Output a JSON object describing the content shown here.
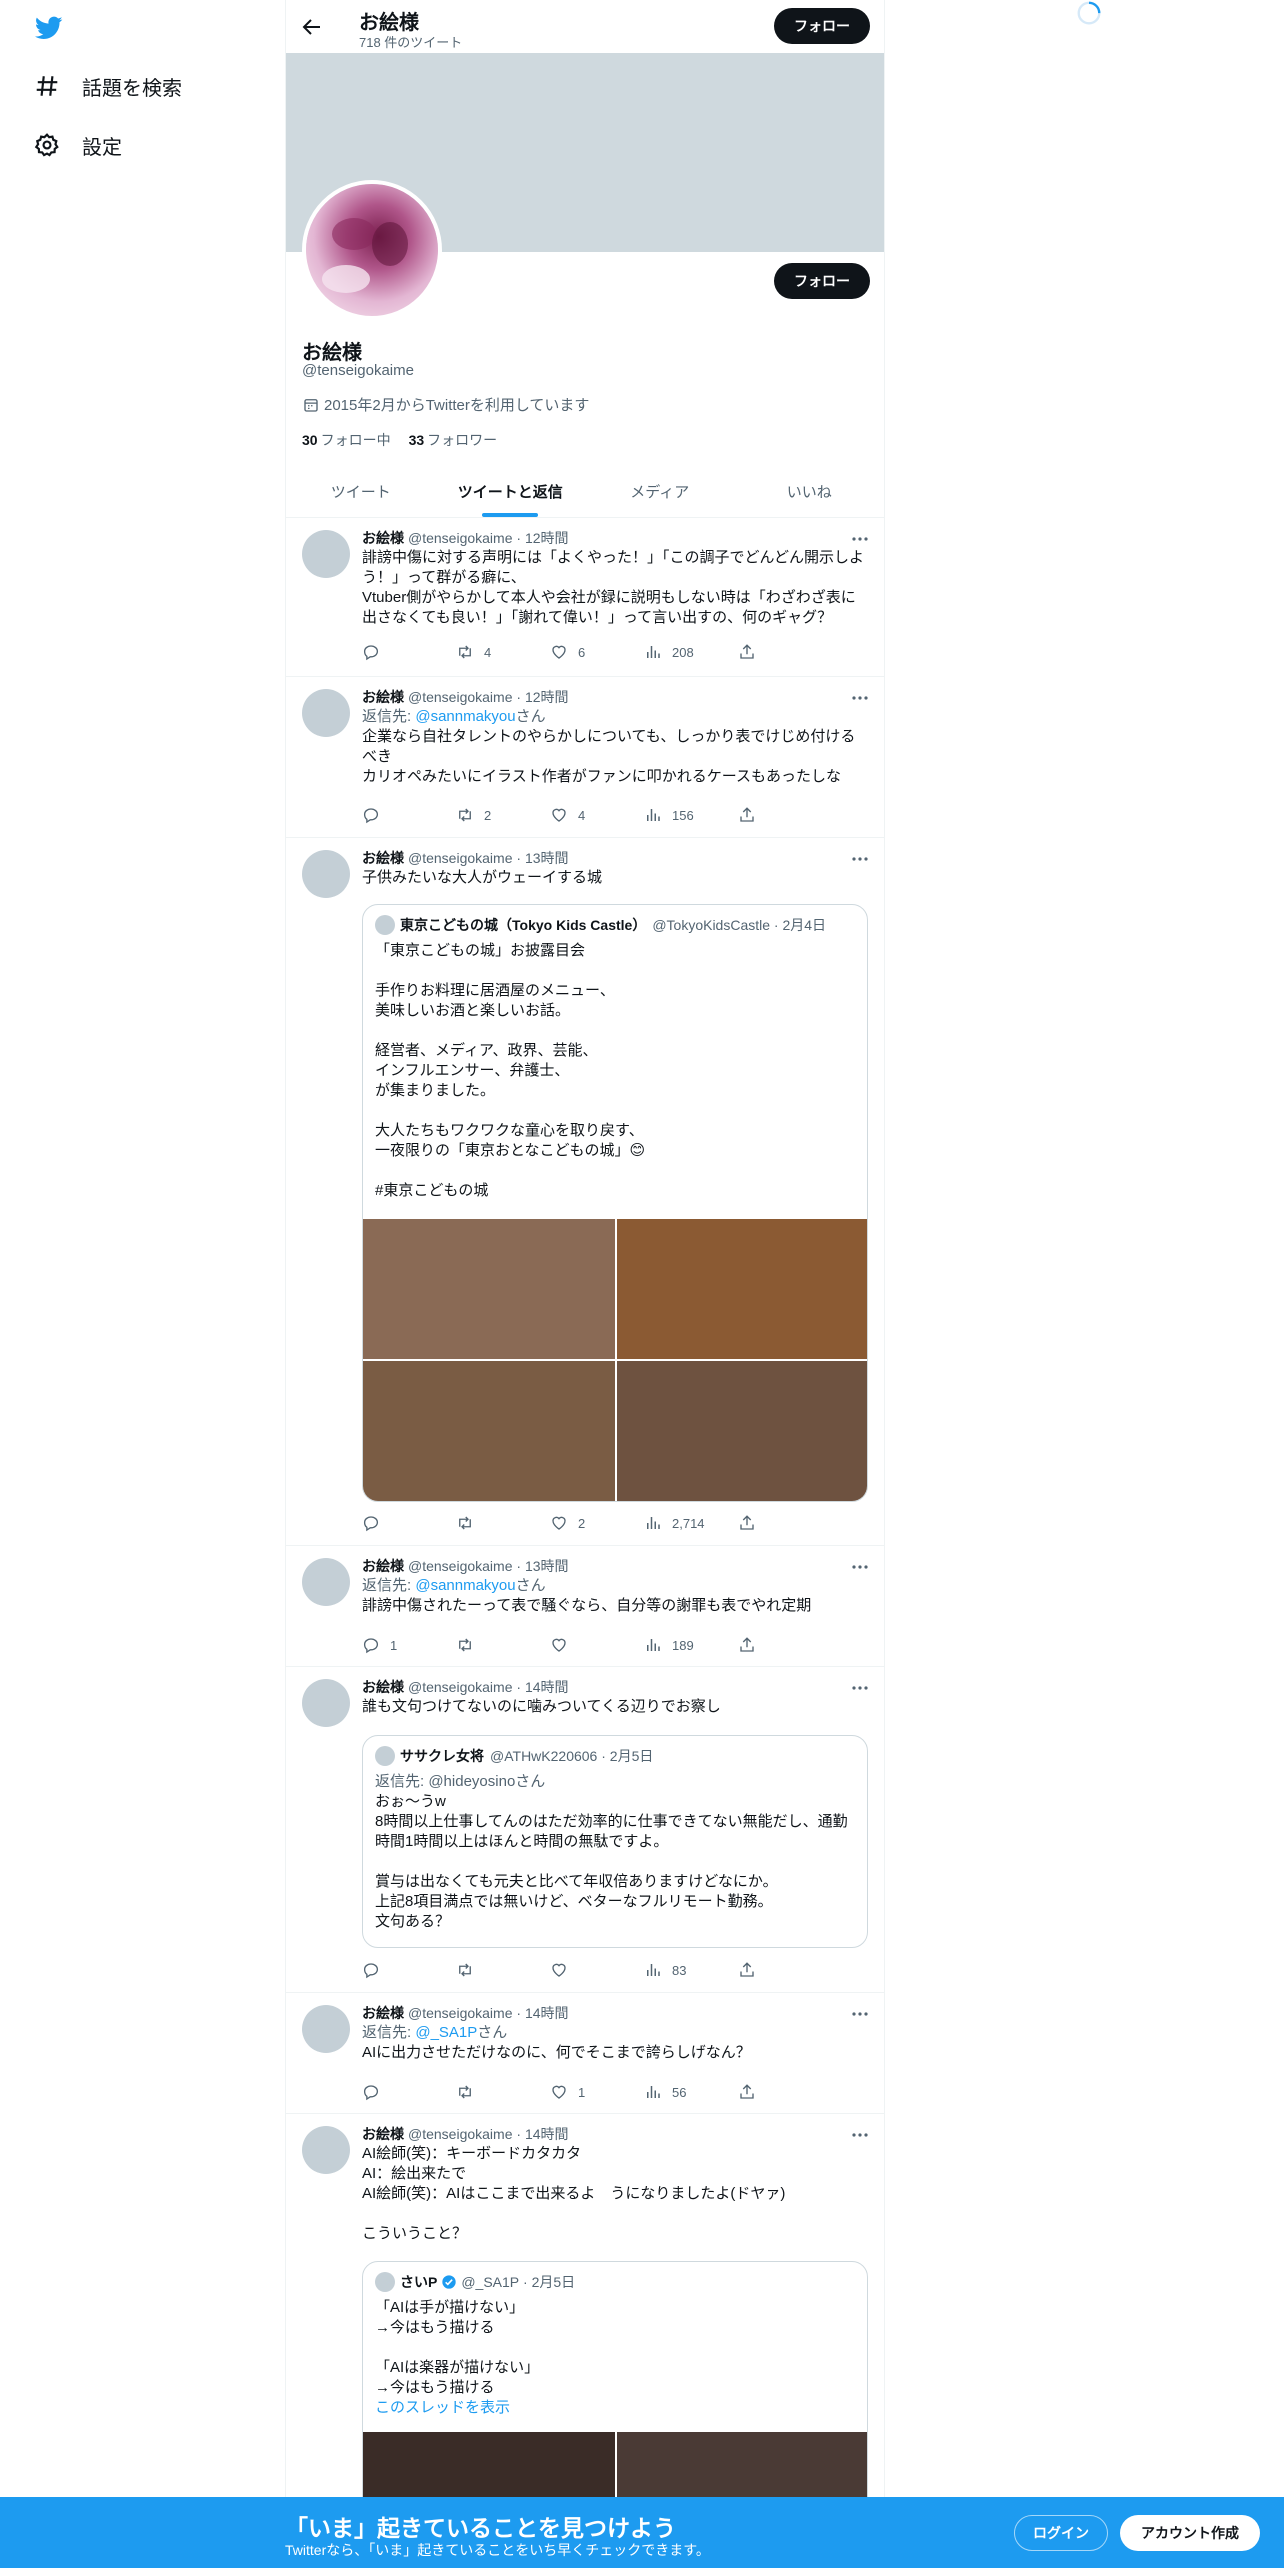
{
  "nav": {
    "items": [
      {
        "label": "話題を検索",
        "icon": "hashtag-icon"
      },
      {
        "label": "設定",
        "icon": "gear-icon"
      }
    ]
  },
  "colors": {
    "accent": "#1d9bf0",
    "banner": "#cfd9de",
    "dark": "#0f1419",
    "muted": "#536471"
  },
  "header": {
    "name": "お絵様",
    "tweet_count": "718 件のツイート",
    "follow_label": "フォロー"
  },
  "profile": {
    "name": "お絵様",
    "handle": "@tenseigokaime",
    "joined": "2015年2月からTwitterを利用しています",
    "following_count": "30",
    "following_label": "フォロー中",
    "followers_count": "33",
    "followers_label": "フォロワー",
    "follow_label": "フォロー"
  },
  "tabs": [
    {
      "label": "ツイート"
    },
    {
      "label": "ツイートと返信"
    },
    {
      "label": "メディア"
    },
    {
      "label": "いいね"
    }
  ],
  "tweets": [
    {
      "name": "お絵様",
      "handle": "@tenseigokaime",
      "time": "12時間",
      "text": "誹謗中傷に対する声明には「よくやった！」「この調子でどんどん開示しよう！」って群がる癖に、\nVtuber側がやらかして本人や会社が録に説明もしない時は「わざわざ表に出さなくても良い！」「謝れて偉い！」って言い出すの、何のギャグ？",
      "replies": "",
      "retweets": "4",
      "likes": "6",
      "views": "208"
    },
    {
      "name": "お絵様",
      "handle": "@tenseigokaime",
      "time": "12時間",
      "reply_prefix": "返信先: ",
      "reply_to": "@sannmakyou",
      "reply_suffix": "さん",
      "text": "企業なら自社タレントのやらかしについても、しっかり表でけじめ付けるべき\nカリオペみたいにイラスト作者がファンに叩かれるケースもあったしな",
      "replies": "",
      "retweets": "2",
      "likes": "4",
      "views": "156"
    },
    {
      "name": "お絵様",
      "handle": "@tenseigokaime",
      "time": "13時間",
      "text": "子供みたいな大人がウェーイする城",
      "quote": {
        "name": "東京こどもの城（Tokyo Kids Castle）",
        "handle": "@TokyoKidsCastle",
        "time": "2月4日",
        "text": "「東京こどもの城」お披露目会\n\n手作りお料理に居酒屋のメニュー、\n美味しいお酒と楽しいお話。\n\n経営者、メディア、政界、芸能、\nインフルエンサー、弁護士、\nが集まりました。\n\n大人たちもワクワクな童心を取り戻す、\n一夜限りの「東京おとなこどもの城」😊\n\n#東京こどもの城",
        "images": [
          "photo-1",
          "photo-2",
          "photo-3",
          "photo-4"
        ],
        "image_colors": [
          "#8a6a55",
          "#8b5a33",
          "#7a5c44",
          "#6e5240"
        ]
      },
      "replies": "",
      "retweets": "",
      "likes": "2",
      "views": "2,714"
    },
    {
      "name": "お絵様",
      "handle": "@tenseigokaime",
      "time": "13時間",
      "reply_prefix": "返信先: ",
      "reply_to": "@sannmakyou",
      "reply_suffix": "さん",
      "text": "誹謗中傷されたーって表で騒ぐなら、自分等の謝罪も表でやれ定期",
      "replies": "1",
      "retweets": "",
      "likes": "",
      "views": "189"
    },
    {
      "name": "お絵様",
      "handle": "@tenseigokaime",
      "time": "14時間",
      "text": "誰も文句つけてないのに噛みついてくる辺りでお察し",
      "quote": {
        "name": "ササクレ女将",
        "handle": "@ATHwK220606",
        "time": "2月5日",
        "reply_line": "返信先: @hideyosinoさん",
        "text": "おぉ〜うw\n8時間以上仕事してんのはただ効率的に仕事できてない無能だし、通勤時間1時間以上はほんと時間の無駄ですよ。\n\n賞与は出なくても元夫と比べて年収倍ありますけどなにか。\n上記8項目満点では無いけど、ベターなフルリモート勤務。\n文句ある？"
      },
      "replies": "",
      "retweets": "",
      "likes": "",
      "views": "83"
    },
    {
      "name": "お絵様",
      "handle": "@tenseigokaime",
      "time": "14時間",
      "reply_prefix": "返信先: ",
      "reply_to": "@_SA1P",
      "reply_suffix": "さん",
      "text": "AIに出力させただけなのに、何でそこまで誇らしげなん？",
      "replies": "",
      "retweets": "",
      "likes": "1",
      "views": "56"
    },
    {
      "name": "お絵様",
      "handle": "@tenseigokaime",
      "time": "14時間",
      "text": "AI絵師(笑)：キーボードカタカタ\nAI：絵出来たで\nAI絵師(笑)：AIはここまで出来るよ　うになりましたよ(ドヤァ)\n\nこういうこと？",
      "quote": {
        "name": "さいP",
        "handle": "@_SA1P",
        "time": "2月5日",
        "text": "「AIは手が描けない」\n→今はもう描ける\n\n「AIは楽器が描けない」\n→今はもう描ける",
        "thread_link": "このスレッドを表示",
        "image_colors": [
          "#3a2c27",
          "#4a3a35"
        ]
      }
    }
  ],
  "bottom": {
    "headline": "「いま」起きていることを見つけよう",
    "sub": "Twitterなら、「いま」起きていることをいち早くチェックできます。",
    "login": "ログイン",
    "signup": "アカウント作成"
  }
}
